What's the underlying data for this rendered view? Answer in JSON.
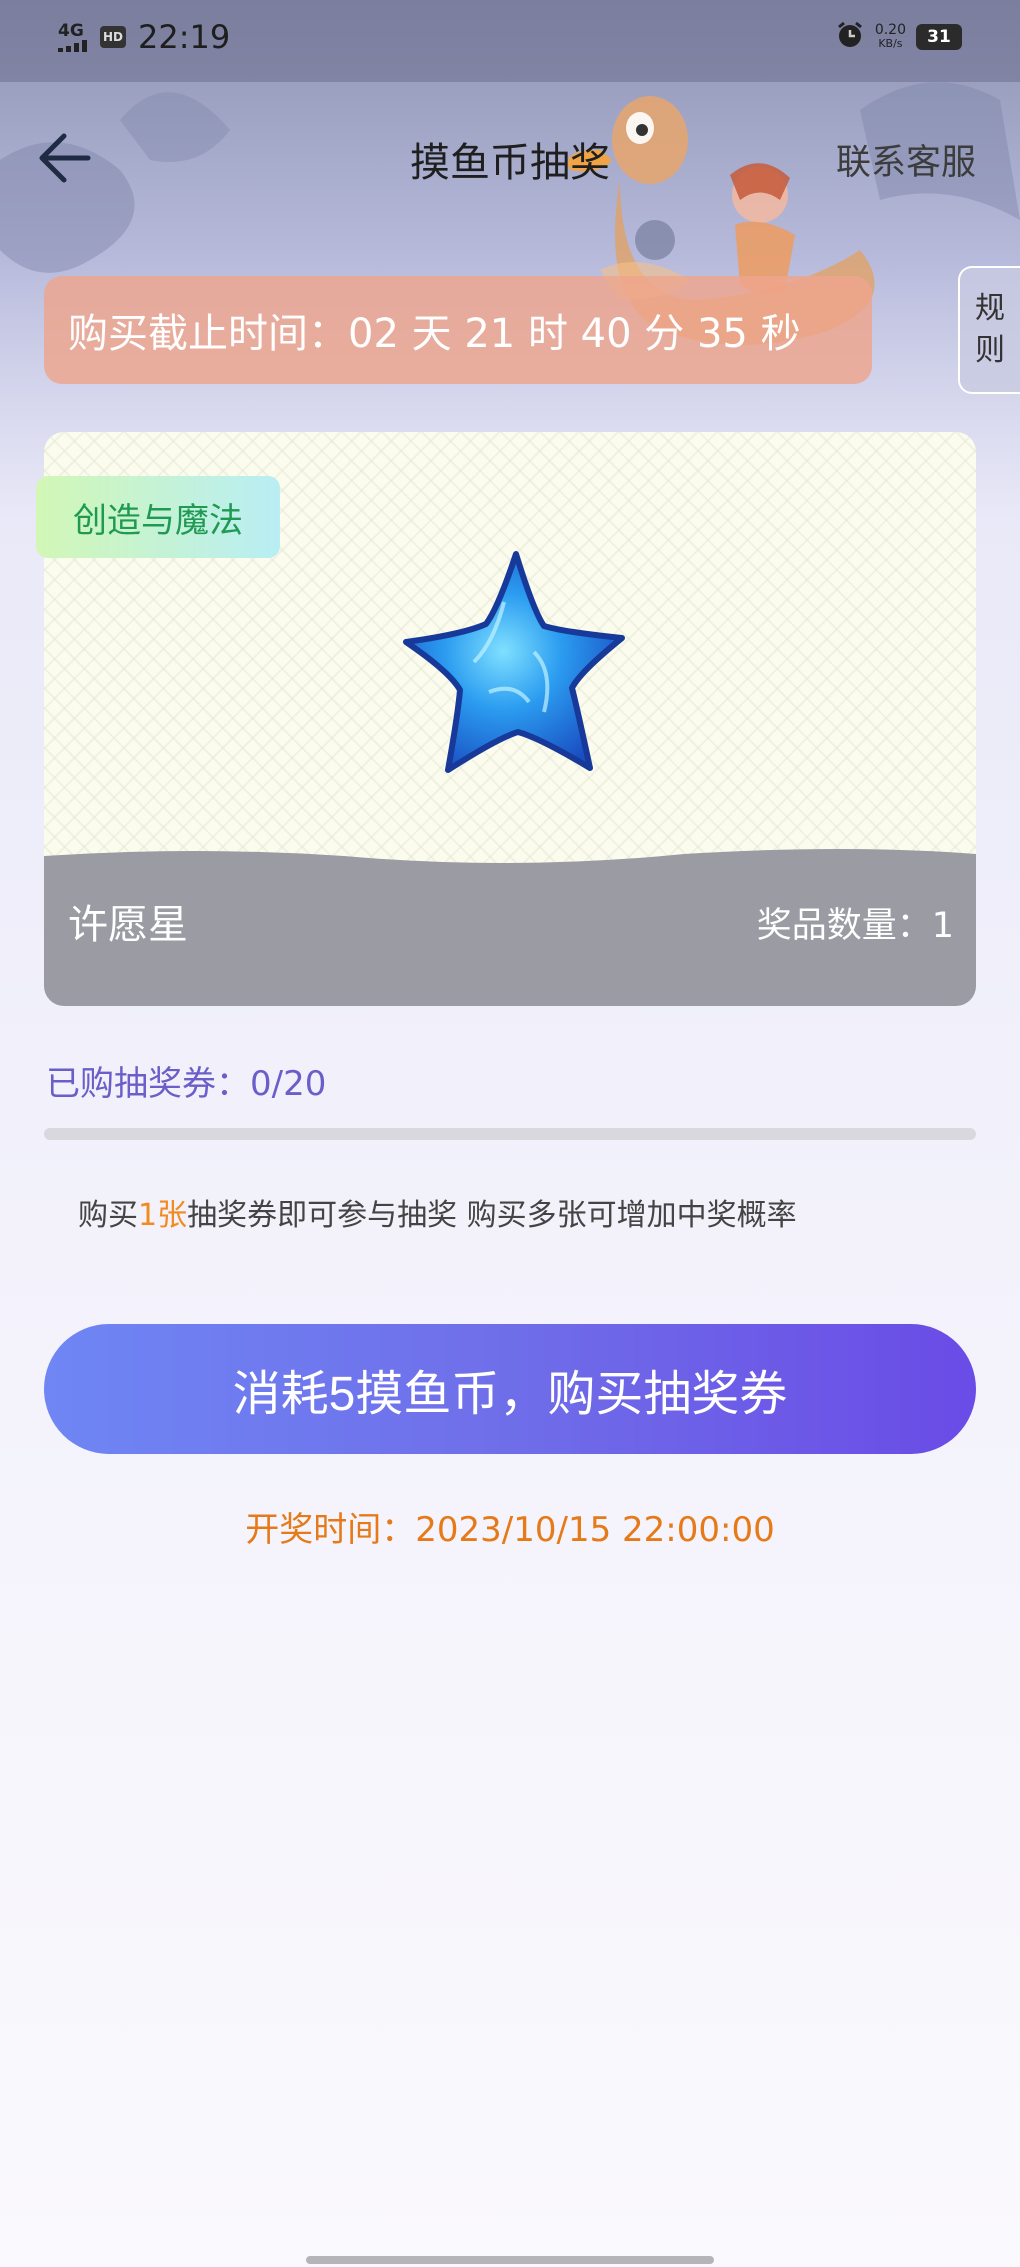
{
  "status_bar": {
    "network": "4G",
    "hd": "HD",
    "time": "22:19",
    "speed_value": "0.20",
    "speed_unit": "KB/s",
    "battery": "31"
  },
  "nav": {
    "title": "摸鱼币抽奖",
    "service_label": "联系客服"
  },
  "rules_tab": {
    "line1": "规",
    "line2": "则"
  },
  "deadline": {
    "text": "购买截止时间：02 天 21 时 40 分 35 秒"
  },
  "prize": {
    "category": "创造与魔法",
    "name": "许愿星",
    "quantity_label": "奖品数量：1"
  },
  "tickets": {
    "bought_label": "已购抽奖券：0/20",
    "bought": 0,
    "total": 20,
    "progress_fraction": 0.0
  },
  "hint": {
    "prefix": "购买",
    "highlight": "1张",
    "suffix": "抽奖券即可参与抽奖 购买多张可增加中奖概率"
  },
  "buy_button": {
    "label": "消耗5摸鱼币，购买抽奖券"
  },
  "draw_time": {
    "text": "开奖时间：2023/10/15 22:00:00"
  },
  "colors": {
    "accent_purple": "#6a5fc9",
    "accent_orange": "#e67a18",
    "deadline_bg": "#eea58c",
    "button_start": "#6f86f4",
    "button_end": "#6a4be6"
  },
  "icons": {
    "back": "arrow-left-icon",
    "prize": "blue-star-icon"
  }
}
